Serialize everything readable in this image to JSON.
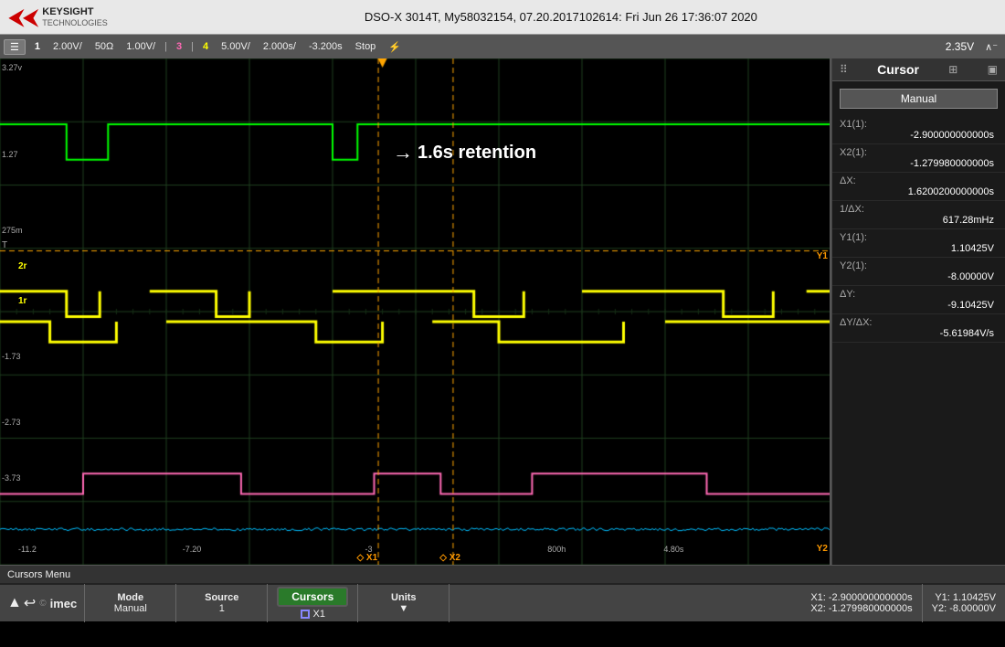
{
  "header": {
    "logo_brand_line1": "KEYSIGHT",
    "logo_brand_line2": "TECHNOLOGIES",
    "title": "DSO-X 3014T, My58032154, 07.20.2017102614: Fri Jun 26 17:36:07 2020"
  },
  "toolbar": {
    "menu_icon": "☰",
    "ch1_label": "1",
    "ch1_scale": "2.00V/",
    "ch1_coupling": "50Ω",
    "ch1_offset": "1.00V/",
    "ch3_label": "3",
    "ch4_label": "4",
    "ch4_scale": "5.00V/",
    "timebase": "2.000s/",
    "delay": "-3.200s",
    "run_status": "Stop",
    "trigger_icon": "⚡",
    "voltage_reading": "2.35V",
    "nav_icon": "∧⁻"
  },
  "cursor_panel": {
    "title": "Cursor",
    "grid_icon": "⠿",
    "window_icon": "⊞",
    "mode_label": "Manual",
    "x1_label": "X1(1):",
    "x1_value": "-2.900000000000s",
    "x2_label": "X2(1):",
    "x2_value": "-1.279980000000s",
    "delta_x_label": "ΔX:",
    "delta_x_value": "1.6200200000000s",
    "inv_delta_x_label": "1/ΔX:",
    "inv_delta_x_value": "617.28mHz",
    "y1_label": "Y1(1):",
    "y1_value": "1.10425V",
    "y2_label": "Y2(1):",
    "y2_value": "-8.00000V",
    "delta_y_label": "ΔY:",
    "delta_y_value": "-9.10425V",
    "delta_y_over_x_label": "ΔY/ΔX:",
    "delta_y_over_x_value": "-5.61984V/s"
  },
  "bottom_status": {
    "label": "Cursors Menu"
  },
  "controls": {
    "mode_label": "Mode",
    "mode_value": "Manual",
    "source_label": "Source",
    "source_value": "1",
    "cursors_label": "Cursors",
    "cursors_x1": "□ X1",
    "units_label": "Units",
    "units_arrow": "▼",
    "x1_info": "X1: -2.900000000000s",
    "x2_info": "X2: -1.279980000000s",
    "y1_info": "Y1: 1.10425V",
    "y2_info": "Y2: -8.00000V"
  },
  "annotation": {
    "text": "1.6s retention",
    "arrow": "→"
  },
  "scale_labels": [
    "3.27v",
    "1.27",
    "275m",
    "2r",
    "1r",
    "-1.73",
    "-2.73",
    "-3.73"
  ],
  "cursor_bottom_labels": {
    "x1": "X1",
    "x2": "X2",
    "y1": "Y1",
    "y2": "Y2",
    "left_bottom1": "-11.2",
    "left_bottom2": "-7.20",
    "left_bottom3": "-3",
    "right_bottom1": "800h",
    "right_bottom2": "4.80s"
  },
  "colors": {
    "ch1": "#00ff00",
    "ch2": "#ffff00",
    "ch3": "#ff69b4",
    "ch4": "#00bfff",
    "cursor": "#ffa500",
    "background": "#000000",
    "grid": "#1a3a1a",
    "panel_bg": "#1a1a1a"
  }
}
